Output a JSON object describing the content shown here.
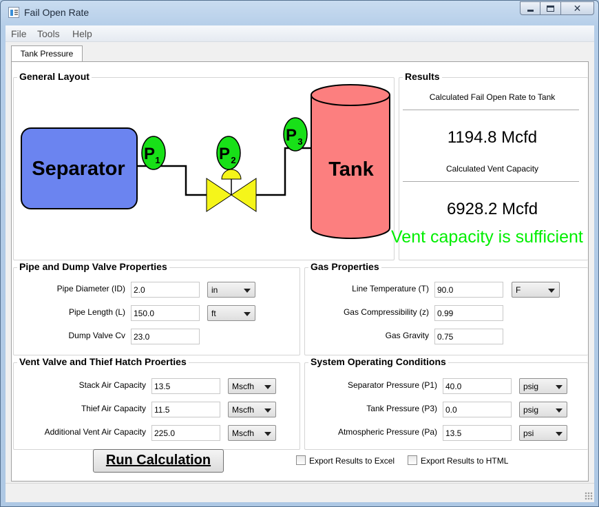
{
  "window": {
    "title": "Fail Open Rate"
  },
  "menu": [
    "File",
    "Tools",
    "Help"
  ],
  "tab": {
    "label": "Tank Pressure"
  },
  "layout": {
    "title": "General Layout",
    "separator_label": "Separator",
    "tank_label": "Tank",
    "gauge_letter": "P",
    "gauges": [
      "1",
      "2",
      "3"
    ]
  },
  "results": {
    "title": "Results",
    "fail_open_label": "Calculated Fail Open Rate to Tank",
    "fail_open_value": "1194.8 Mcfd",
    "vent_capacity_label": "Calculated Vent Capacity",
    "vent_capacity_value": "6928.2 Mcfd",
    "status_message": "Vent capacity is sufficient",
    "status_color": "#00ee00"
  },
  "pipe_valve": {
    "title": "Pipe and Dump Valve Properties",
    "rows": [
      {
        "label": "Pipe Diameter (ID)",
        "value": "2.0",
        "unit": "in"
      },
      {
        "label": "Pipe Length (L)",
        "value": "150.0",
        "unit": "ft"
      },
      {
        "label": "Dump Valve Cv",
        "value": "23.0"
      }
    ]
  },
  "gas": {
    "title": "Gas Properties",
    "rows": [
      {
        "label": "Line Temperature (T)",
        "value": "90.0",
        "unit": "F"
      },
      {
        "label": "Gas Compressibility (z)",
        "value": "0.99"
      },
      {
        "label": "Gas Gravity",
        "value": "0.75"
      }
    ]
  },
  "vent": {
    "title": "Vent Valve and Thief Hatch Proerties",
    "rows": [
      {
        "label": "Stack Air Capacity",
        "value": "13.5",
        "unit": "Mscfh"
      },
      {
        "label": "Thief Air Capacity",
        "value": "11.5",
        "unit": "Mscfh"
      },
      {
        "label": "Additional Vent Air Capacity",
        "value": "225.0",
        "unit": "Mscfh"
      }
    ]
  },
  "system": {
    "title": "System Operating Conditions",
    "rows": [
      {
        "label": "Separator Pressure (P1)",
        "value": "40.0",
        "unit": "psig"
      },
      {
        "label": "Tank Pressure (P3)",
        "value": "0.0",
        "unit": "psig"
      },
      {
        "label": "Atmospheric Pressure (Pa)",
        "value": "13.5",
        "unit": "psi"
      }
    ]
  },
  "actions": {
    "run_label": "Run Calculation",
    "export_excel_label": "Export Results to Excel",
    "export_excel_checked": false,
    "export_html_label": "Export Results to HTML",
    "export_html_checked": false
  },
  "colors": {
    "separator_fill": "#6b84f0",
    "tank_fill": "#fc7f7f",
    "gauge_fill": "#18e018",
    "valve_fill": "#f5f51a"
  }
}
